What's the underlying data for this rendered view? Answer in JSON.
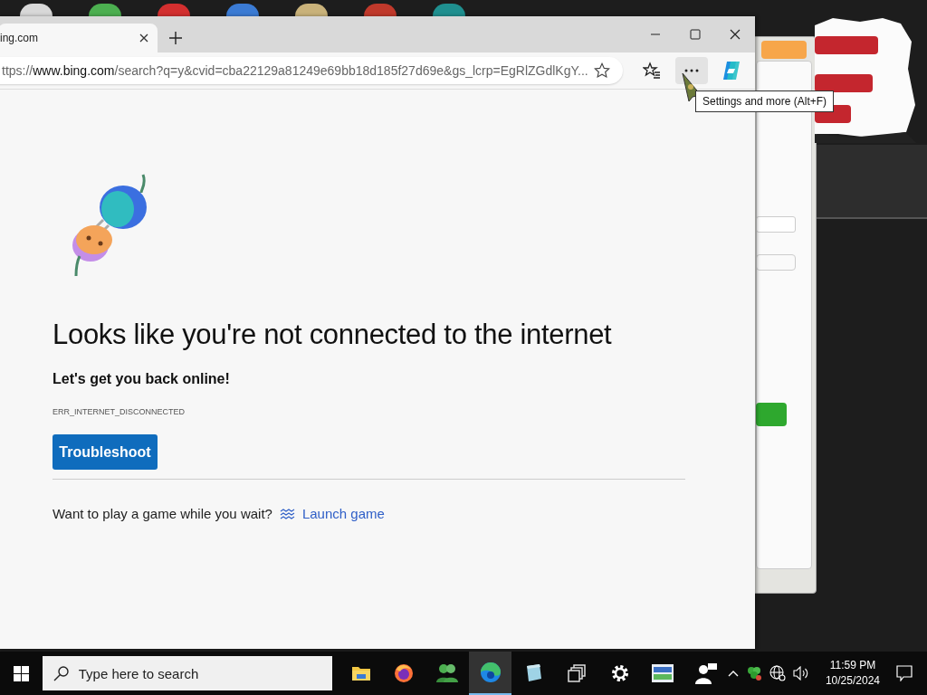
{
  "desktop": {
    "icons": [
      {
        "color": "#d8d8d8"
      },
      {
        "color": "#4caf50"
      },
      {
        "color": "#d32f2f"
      },
      {
        "color": "#3b7bd4"
      },
      {
        "color": "#c9b27a"
      },
      {
        "color": "#c0392b"
      },
      {
        "color": "#1f8f8f"
      }
    ]
  },
  "browser": {
    "tabs": [
      {
        "title": "ing.com",
        "selected": true
      }
    ],
    "address": {
      "url": "ttps://**www.bing.com**/search?q=y&cvid=cba22129a81249e69bb18d185f27d69e&gs_lcrp=EgRlZGdlKgY..."
    },
    "toolbar": [
      {
        "kind": "favorites",
        "selected": false
      },
      {
        "kind": "more",
        "selected": true
      },
      {
        "kind": "copilot",
        "selected": false
      }
    ],
    "tooltip": "Settings and more (Alt+F)",
    "page": {
      "heading": "Looks like you're not connected to the internet",
      "subheading": "Let's get you back online!",
      "error_code": "ERR_INTERNET_DISCONNECTED",
      "button": "Troubleshoot",
      "game_prompt": "Want to play a game while you wait?",
      "game_link": "Launch game"
    }
  },
  "taskbar": {
    "search": {
      "placeholder": "Type here to search"
    },
    "apps": [
      {
        "kind": "folder",
        "selected": false
      },
      {
        "kind": "firefox",
        "selected": false
      },
      {
        "kind": "people",
        "selected": false
      },
      {
        "kind": "edge",
        "selected": true
      },
      {
        "kind": "notepad",
        "selected": false
      },
      {
        "kind": "windows",
        "selected": false
      },
      {
        "kind": "settings",
        "selected": false
      },
      {
        "kind": "display",
        "selected": false
      },
      {
        "kind": "user",
        "selected": false
      }
    ],
    "time": "11:59 PM",
    "date": "10/25/2024"
  }
}
